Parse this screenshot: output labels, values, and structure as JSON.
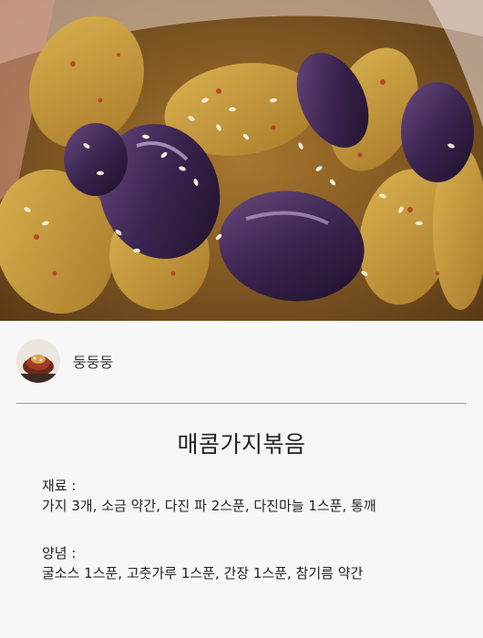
{
  "post": {
    "author_name": "둥둥둥",
    "title": "매콤가지볶음",
    "ingredients_label": "재료 :",
    "ingredients_text": "가지 3개, 소금 약간, 다진 파 2스푼, 다진마늘 1스푼, 통깨",
    "sauce_label": "양념 :",
    "sauce_text": "굴소스 1스푼, 고춧가루 1스푼, 간장 1스푼, 참기름 약간"
  },
  "photo": {
    "subject": "stir-fried spicy eggplant with sesame seeds"
  },
  "colors": {
    "card_background": "#f7f7f7",
    "divider": "#9a9a9a"
  }
}
